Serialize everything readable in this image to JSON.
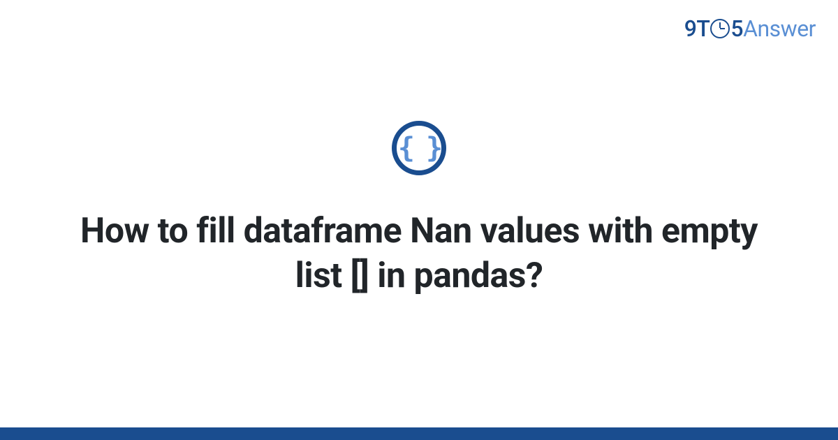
{
  "logo": {
    "part1": "9T",
    "part2": "5",
    "part3": "Answer"
  },
  "icon": {
    "name": "code-braces-icon",
    "glyph": "{ }"
  },
  "title": "How to fill dataframe Nan values with empty list [] in pandas?",
  "colors": {
    "primary": "#1a4d8f",
    "accent": "#5a8fd4"
  }
}
